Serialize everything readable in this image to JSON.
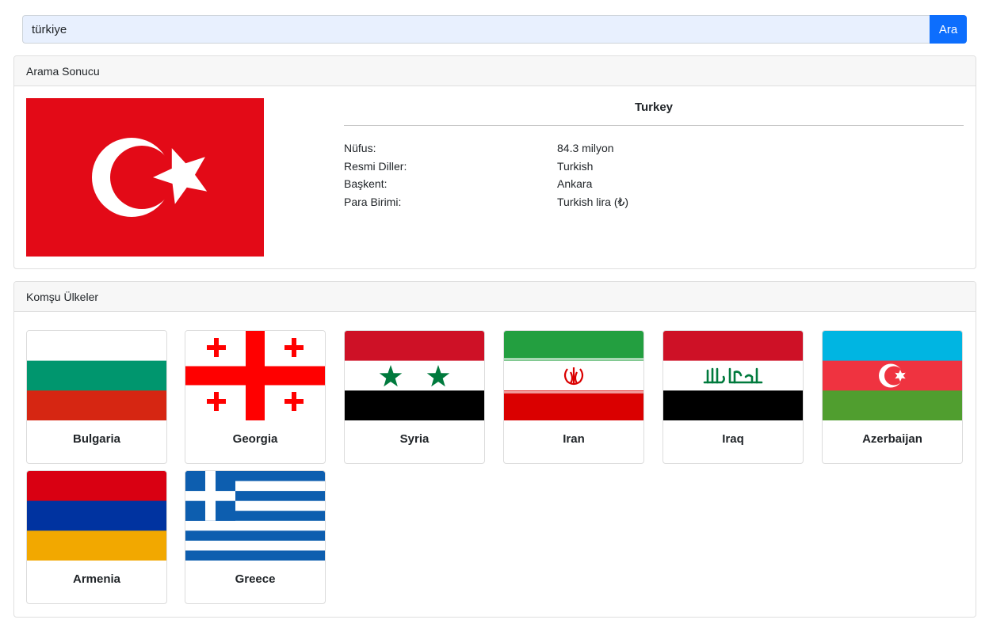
{
  "search": {
    "value": "türkiye",
    "button_label": "Ara"
  },
  "result": {
    "header": "Arama Sonucu",
    "country_name": "Turkey",
    "flag_icon": "turkey-flag",
    "details": [
      {
        "label": "Nüfus:",
        "value": "84.3 milyon"
      },
      {
        "label": "Resmi Diller:",
        "value": "Turkish"
      },
      {
        "label": "Başkent:",
        "value": "Ankara"
      },
      {
        "label": "Para Birimi:",
        "value": "Turkish lira (₺)"
      }
    ]
  },
  "neighbors": {
    "header": "Komşu Ülkeler",
    "items": [
      {
        "name": "Bulgaria",
        "flag_icon": "bulgaria-flag"
      },
      {
        "name": "Georgia",
        "flag_icon": "georgia-flag"
      },
      {
        "name": "Syria",
        "flag_icon": "syria-flag"
      },
      {
        "name": "Iran",
        "flag_icon": "iran-flag"
      },
      {
        "name": "Iraq",
        "flag_icon": "iraq-flag"
      },
      {
        "name": "Azerbaijan",
        "flag_icon": "azerbaijan-flag"
      },
      {
        "name": "Armenia",
        "flag_icon": "armenia-flag"
      },
      {
        "name": "Greece",
        "flag_icon": "greece-flag"
      }
    ]
  },
  "colors": {
    "primary": "#0d6efd",
    "input_bg": "#e8f0fe",
    "card_header_bg": "#f7f7f7",
    "turkey_red": "#e30a17"
  }
}
